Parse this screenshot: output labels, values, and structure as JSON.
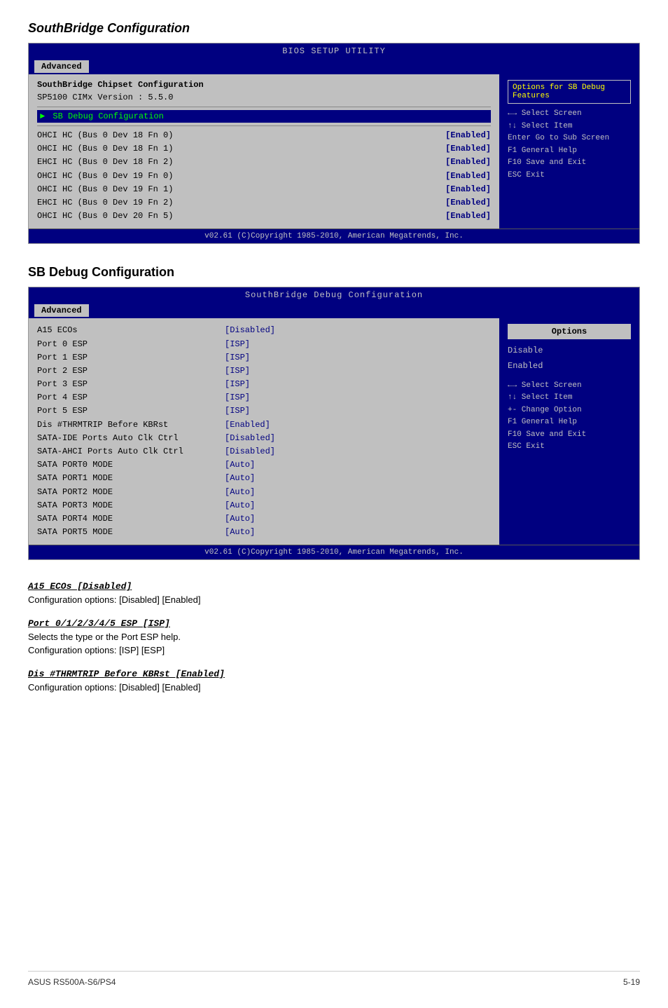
{
  "page": {
    "footer_left": "ASUS RS500A-S6/PS4",
    "footer_right": "5-19"
  },
  "section1": {
    "title": "SouthBridge Configuration",
    "bios": {
      "header": "BIOS SETUP UTILITY",
      "tab": "Advanced",
      "left_title": "SouthBridge Chipset Configuration",
      "version_line": "SP5100 CIMx Version : 5.5.0",
      "submenu_label": "SB Debug Configuration",
      "devices": [
        {
          "name": "OHCI HC (Bus 0 Dev 18 Fn 0)",
          "value": "[Enabled]"
        },
        {
          "name": "OHCI HC (Bus 0 Dev 18 Fn 1)",
          "value": "[Enabled]"
        },
        {
          "name": "EHCI HC (Bus 0 Dev 18 Fn 2)",
          "value": "[Enabled]"
        },
        {
          "name": "OHCI HC (Bus 0 Dev 19 Fn 0)",
          "value": "[Enabled]"
        },
        {
          "name": "OHCI HC (Bus 0 Dev 19 Fn 1)",
          "value": "[Enabled]"
        },
        {
          "name": "EHCI HC (Bus 0 Dev 19 Fn 2)",
          "value": "[Enabled]"
        },
        {
          "name": "OHCI HC (Bus 0 Dev 20 Fn 5)",
          "value": "[Enabled]"
        }
      ],
      "right_label": "Options for SB Debug Features",
      "key_help": [
        {
          "key": "←→",
          "desc": "Select Screen"
        },
        {
          "key": "↑↓",
          "desc": "Select Item"
        },
        {
          "key": "Enter",
          "desc": "Go to Sub Screen"
        },
        {
          "key": "F1",
          "desc": "General Help"
        },
        {
          "key": "F10",
          "desc": "Save and Exit"
        },
        {
          "key": "ESC",
          "desc": "Exit"
        }
      ],
      "footer": "v02.61  (C)Copyright 1985-2010, American Megatrends, Inc."
    }
  },
  "section2": {
    "title": "SB Debug Configuration",
    "bios": {
      "header": "SouthBridge Debug Configuration",
      "tab": "Advanced",
      "devices": [
        {
          "name": "A15 ECOs",
          "value": "[Disabled]"
        },
        {
          "name": "Port 0 ESP",
          "value": "[ISP]"
        },
        {
          "name": "Port 1 ESP",
          "value": "[ISP]"
        },
        {
          "name": "Port 2 ESP",
          "value": "[ISP]"
        },
        {
          "name": "Port 3 ESP",
          "value": "[ISP]"
        },
        {
          "name": "Port 4 ESP",
          "value": "[ISP]"
        },
        {
          "name": "Port 5 ESP",
          "value": "[ISP]"
        },
        {
          "name": "Dis #THRMTRIP Before KBRst",
          "value": "[Enabled]"
        },
        {
          "name": "SATA-IDE Ports Auto Clk Ctrl",
          "value": "[Disabled]"
        },
        {
          "name": "SATA-AHCI Ports Auto Clk Ctrl",
          "value": "[Disabled]"
        },
        {
          "name": "SATA PORT0 MODE",
          "value": "[Auto]"
        },
        {
          "name": "SATA PORT1 MODE",
          "value": "[Auto]"
        },
        {
          "name": "SATA PORT2 MODE",
          "value": "[Auto]"
        },
        {
          "name": "SATA PORT3 MODE",
          "value": "[Auto]"
        },
        {
          "name": "SATA PORT4 MODE",
          "value": "[Auto]"
        },
        {
          "name": "SATA PORT5 MODE",
          "value": "[Auto]"
        }
      ],
      "right_options_label": "Options",
      "right_options": [
        "Disable",
        "Enabled"
      ],
      "key_help": [
        {
          "key": "←→",
          "desc": "Select Screen"
        },
        {
          "key": "↑↓",
          "desc": "Select Item"
        },
        {
          "key": "+-",
          "desc": "Change Option"
        },
        {
          "key": "F1",
          "desc": "General Help"
        },
        {
          "key": "F10",
          "desc": "Save and Exit"
        },
        {
          "key": "ESC",
          "desc": "Exit"
        }
      ],
      "footer": "v02.61  (C)Copyright 1985-2010, American Megatrends, Inc."
    },
    "descriptions": [
      {
        "title": "A15 ECOs [Disabled]",
        "lines": [
          "Configuration options: [Disabled] [Enabled]"
        ]
      },
      {
        "title": "Port 0/1/2/3/4/5 ESP [ISP]",
        "lines": [
          "Selects the type or the Port ESP help.",
          "Configuration options: [ISP] [ESP]"
        ]
      },
      {
        "title": "Dis #THRMTRIP Before KBRst [Enabled]",
        "lines": [
          "Configuration options: [Disabled] [Enabled]"
        ]
      }
    ]
  }
}
